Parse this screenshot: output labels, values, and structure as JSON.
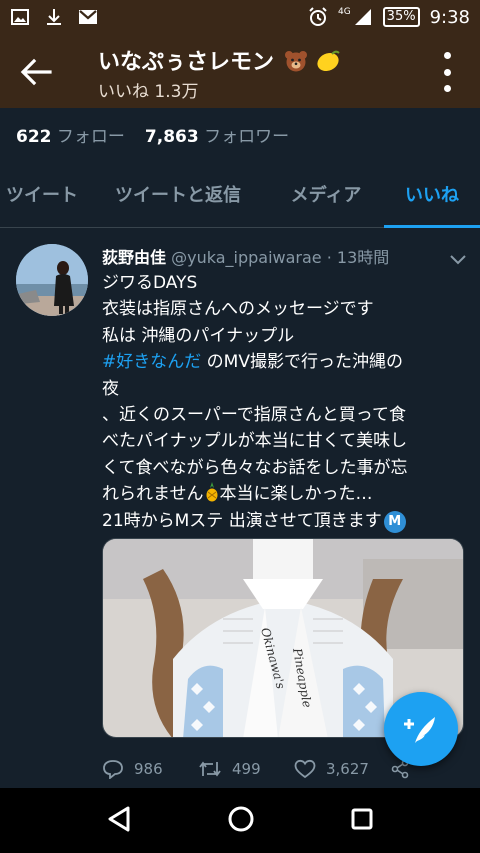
{
  "status_bar": {
    "network": "4G",
    "battery": "35%",
    "time": "9:38",
    "icons_left": [
      "image-icon",
      "download-icon",
      "gmail-icon"
    ],
    "icons_right": [
      "alarm-icon",
      "signal-icon",
      "battery-icon"
    ]
  },
  "app_bar": {
    "title": "いなぷぅさレモン",
    "subtitle": "いいね 1.3万",
    "back_icon": "arrow-back-icon",
    "menu_icon": "more-vertical-icon"
  },
  "profile_counts": {
    "following_count": "622",
    "following_label": "フォロー",
    "followers_count": "7,863",
    "followers_label": "フォロワー"
  },
  "tabs": [
    {
      "label": "ツイート",
      "active": false
    },
    {
      "label": "ツイートと返信",
      "active": false
    },
    {
      "label": "メディア",
      "active": false
    },
    {
      "label": "いいね",
      "active": true
    }
  ],
  "tweet": {
    "author_name": "荻野由佳",
    "handle": "@yuka_ippaiwarae",
    "separator": " · ",
    "time": "13時間",
    "lines": {
      "l1": "ジワるDAYS",
      "l2": "衣装は指原さんへのメッセージです",
      "l3": "私は 沖縄のパイナップル",
      "l4_hashtag": "#好きなんだ",
      "l4_rest": " のMV撮影で行った沖縄の",
      "l5": "夜",
      "l6": "、近くのスーパーで指原さんと買って食",
      "l7": "べたパイナップルが本当に甘くて美味し",
      "l8": "くて食べながら色々なお話をした事が忘",
      "l9_a": "れられません",
      "l9_b": "本当に楽しかった…",
      "l10": "21時からMステ 出演させて頂きます",
      "badge": "M"
    },
    "media_text": {
      "line1": "Okinawa's",
      "line2": "Pineapple"
    },
    "actions": {
      "replies": "986",
      "retweets": "499",
      "likes": "3,627"
    }
  },
  "colors": {
    "accent": "#1da1f2",
    "background": "#15202b",
    "appbar": "#3a2818",
    "muted": "#8899a6"
  }
}
